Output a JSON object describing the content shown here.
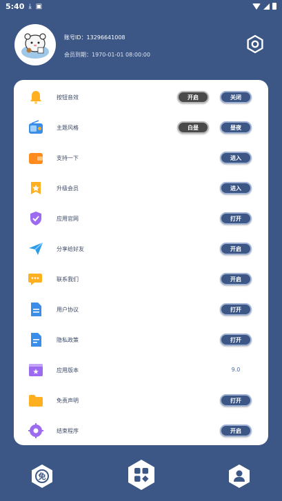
{
  "status_bar": {
    "time": "5:40"
  },
  "profile": {
    "account_id": "账号ID：13296641008",
    "member_expiry": "会员到期：1970-01-01 08:00:00"
  },
  "settings": [
    {
      "label": "按钮音效",
      "icon": "bell-icon",
      "color": "#ffb020",
      "buttons": [
        "开启",
        "关闭"
      ],
      "button_styles": [
        "dark",
        "blue"
      ]
    },
    {
      "label": "主题风格",
      "icon": "theme-radio-icon",
      "color": "#3a8de8",
      "buttons": [
        "白昼",
        "昼夜"
      ],
      "button_styles": [
        "dark",
        "blue"
      ]
    },
    {
      "label": "支持一下",
      "icon": "wallet-icon",
      "color": "#ff8a1e",
      "buttons": [
        "进入"
      ],
      "button_styles": [
        "blue"
      ]
    },
    {
      "label": "升级会员",
      "icon": "vip-badge-icon",
      "color": "#ffb020",
      "buttons": [
        "进入"
      ],
      "button_styles": [
        "blue"
      ]
    },
    {
      "label": "应用官网",
      "icon": "shield-icon",
      "color": "#9d6bf0",
      "buttons": [
        "打开"
      ],
      "button_styles": [
        "blue"
      ]
    },
    {
      "label": "分享给好友",
      "icon": "paper-plane-icon",
      "color": "#2d9ce8",
      "buttons": [
        "开启"
      ],
      "button_styles": [
        "blue"
      ]
    },
    {
      "label": "联系我们",
      "icon": "chat-icon",
      "color": "#ffb020",
      "buttons": [
        "开启"
      ],
      "button_styles": [
        "blue"
      ]
    },
    {
      "label": "用户协议",
      "icon": "document-icon",
      "color": "#3a8de8",
      "buttons": [
        "打开"
      ],
      "button_styles": [
        "blue"
      ]
    },
    {
      "label": "隐私政策",
      "icon": "privacy-doc-icon",
      "color": "#3a8de8",
      "buttons": [
        "打开"
      ],
      "button_styles": [
        "blue"
      ]
    },
    {
      "label": "应用版本",
      "icon": "version-icon",
      "color": "#9d6bf0",
      "value": "9.0"
    },
    {
      "label": "免责声明",
      "icon": "folder-icon",
      "color": "#ffb020",
      "buttons": [
        "打开"
      ],
      "button_styles": [
        "blue"
      ]
    },
    {
      "label": "结束程序",
      "icon": "exit-gear-icon",
      "color": "#9d6bf0",
      "buttons": [
        "开启"
      ],
      "button_styles": [
        "blue"
      ]
    }
  ],
  "bottom_nav": {
    "left": "免",
    "left_icon": "free-icon",
    "center_icon": "apps-grid-icon",
    "right_icon": "user-icon"
  }
}
